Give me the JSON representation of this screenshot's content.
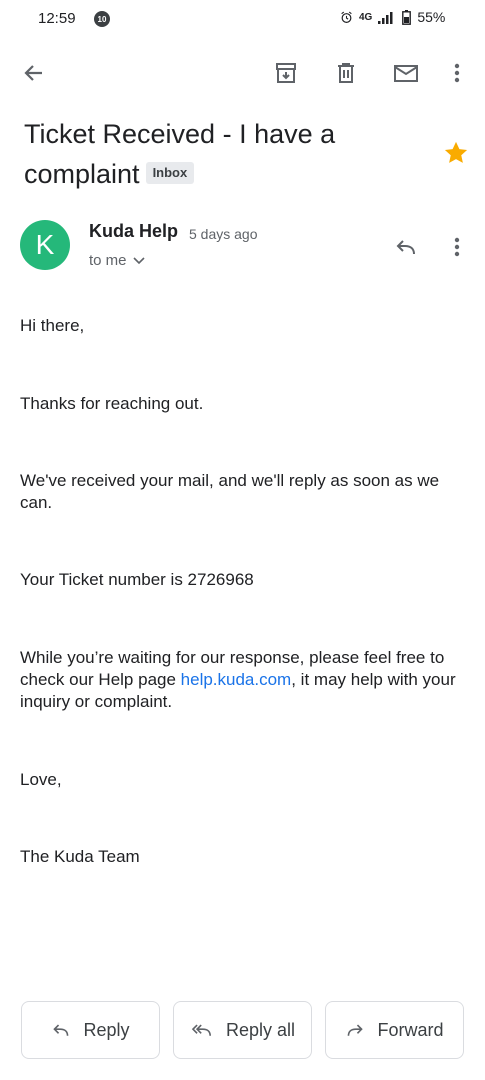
{
  "status_bar": {
    "time": "12:59",
    "notif_badge": "10",
    "network": "4G",
    "battery": "55%"
  },
  "email": {
    "subject": "Ticket Received - I have a complaint",
    "label": "Inbox",
    "sender": {
      "initial": "K",
      "name": "Kuda Help",
      "time": "5 days ago",
      "to": "to me",
      "avatar_color": "#25b87a"
    },
    "body": {
      "p1": "Hi there,",
      "p2": "Thanks for reaching out.",
      "p3": "We've received your mail, and we'll reply as soon as we can.",
      "p4": "Your Ticket number is 2726968",
      "p5_before": "While you’re waiting for our response, please feel free to check our Help page ",
      "p5_link": "help.kuda.com",
      "p5_after": ", it may help with your inquiry or complaint.",
      "p6": "Love,",
      "p7": "The Kuda Team"
    }
  },
  "actions": {
    "reply": "Reply",
    "reply_all": "Reply all",
    "forward": "Forward"
  },
  "colors": {
    "star": "#f9ab00",
    "link": "#1a73e8"
  }
}
